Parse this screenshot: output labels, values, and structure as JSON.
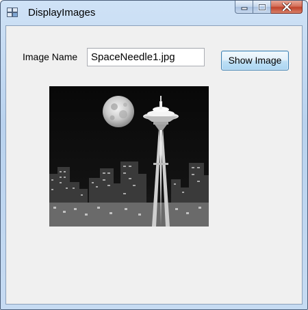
{
  "window": {
    "title": "DisplayImages",
    "app_icon": "form-window-icon",
    "controls": [
      "minimize-icon",
      "maximize-icon",
      "close-icon"
    ]
  },
  "form": {
    "image_name_label": "Image Name",
    "image_name_value": "SpaceNeedle1.jpg",
    "show_button_label": "Show Image"
  },
  "picture": {
    "subject": "Space Needle at night with full moon over Seattle skyline"
  }
}
